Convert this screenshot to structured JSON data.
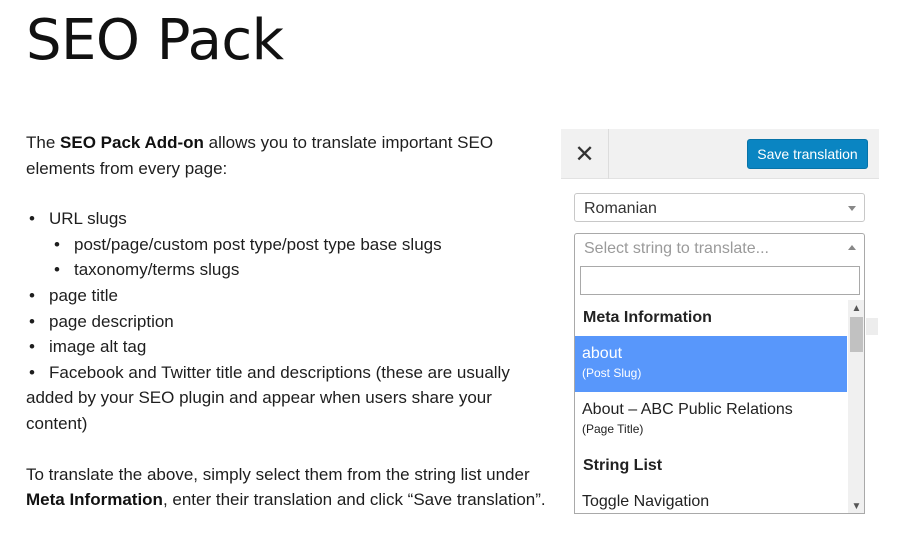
{
  "title": "SEO Pack",
  "intro": {
    "pre": "The ",
    "bold": "SEO Pack Add-on",
    "post": " allows you to translate important SEO elements from every page:"
  },
  "bullets": [
    "URL slugs",
    "post/page/custom post type/post type base slugs",
    "taxonomy/terms slugs",
    "page title",
    "page description",
    "image alt tag",
    "Facebook and Twitter title and descriptions (these are usually added by your SEO plugin and appear when users share your content)"
  ],
  "outro": {
    "pre": "To translate the above, simply select them from the string list under ",
    "bold": "Meta Information",
    "post": ", enter their translation and click “Save translation”."
  },
  "widget": {
    "close_icon": "✕",
    "save_label": "Save translation",
    "language": "Romanian",
    "string_placeholder": "Select string to translate...",
    "search_value": "",
    "groups": [
      {
        "label": "Meta Information",
        "options": [
          {
            "main": "about",
            "sub": "(Post Slug)",
            "highlighted": true
          },
          {
            "main": "About – ABC Public Relations",
            "sub": "(Page Title)",
            "highlighted": false
          }
        ]
      },
      {
        "label": "String List",
        "options": [
          {
            "main": "Toggle Navigation",
            "sub": "",
            "highlighted": false
          }
        ]
      }
    ],
    "colors": {
      "save_button": "#0a85c2",
      "highlight": "#5897fb"
    }
  }
}
